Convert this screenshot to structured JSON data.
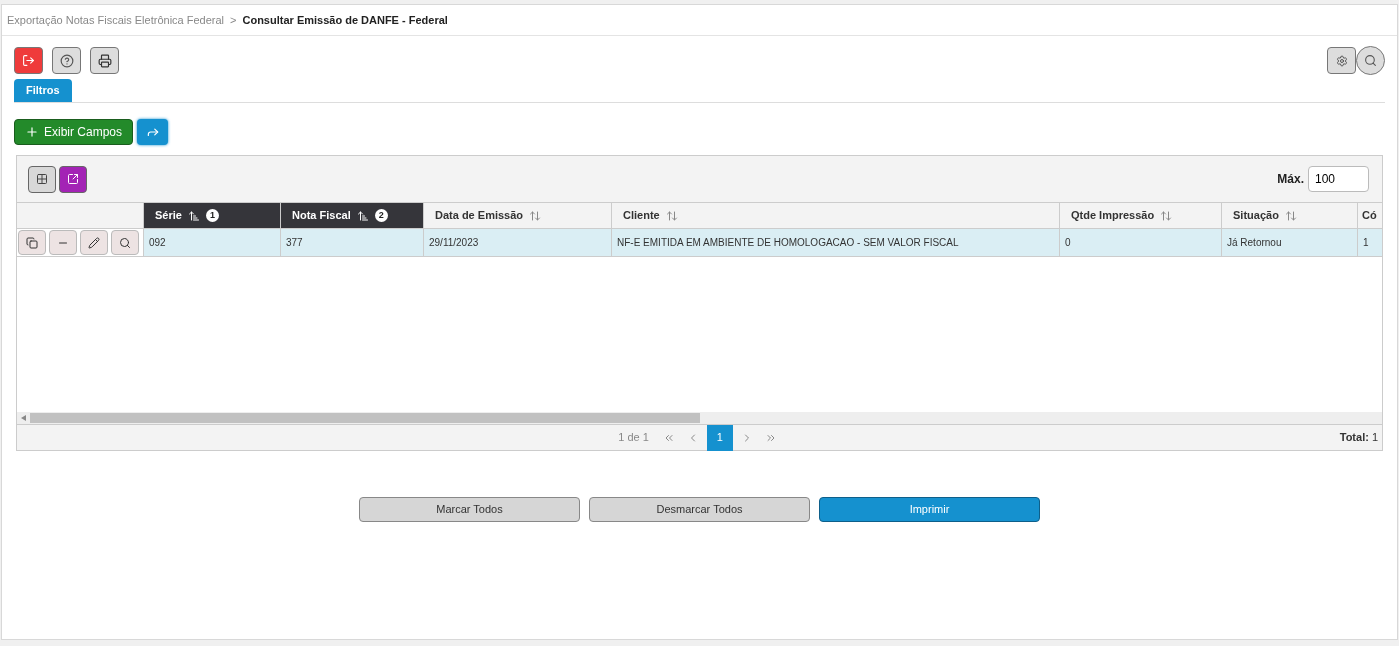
{
  "breadcrumb": {
    "parent": "Exportação Notas Fiscais Eletrônica Federal",
    "separator": ">",
    "current": "Consultar Emissão de DANFE - Federal"
  },
  "tabs": [
    {
      "label": "Filtros",
      "selected": true
    }
  ],
  "actions": {
    "show_fields": "Exibir Campos"
  },
  "grid": {
    "max_label": "Máx.",
    "max_value": "100",
    "columns": [
      {
        "label": "Série",
        "sorted": true,
        "sort_order": "1"
      },
      {
        "label": "Nota Fiscal",
        "sorted": true,
        "sort_order": "2"
      },
      {
        "label": "Data de Emissão",
        "sorted": false
      },
      {
        "label": "Cliente",
        "sorted": false
      },
      {
        "label": "Qtde Impressão",
        "sorted": false
      },
      {
        "label": "Situação",
        "sorted": false
      },
      {
        "label": "Có",
        "sorted": false
      }
    ],
    "rows": [
      {
        "selected": true,
        "cells": [
          "092",
          "377",
          "29/11/2023",
          "NF-E EMITIDA EM AMBIENTE DE HOMOLOGACAO - SEM VALOR FISCAL",
          "0",
          "Já Retornou",
          "1"
        ]
      }
    ],
    "pagination": {
      "info": "1 de 1",
      "pages": [
        {
          "label": "1",
          "selected": true
        }
      ],
      "total_label": "Total:",
      "total": "1"
    }
  },
  "buttons": [
    {
      "label": "Marcar Todos",
      "kind": "secondary"
    },
    {
      "label": "Desmarcar Todos",
      "kind": "secondary"
    },
    {
      "label": "Imprimir",
      "kind": "primary"
    }
  ]
}
